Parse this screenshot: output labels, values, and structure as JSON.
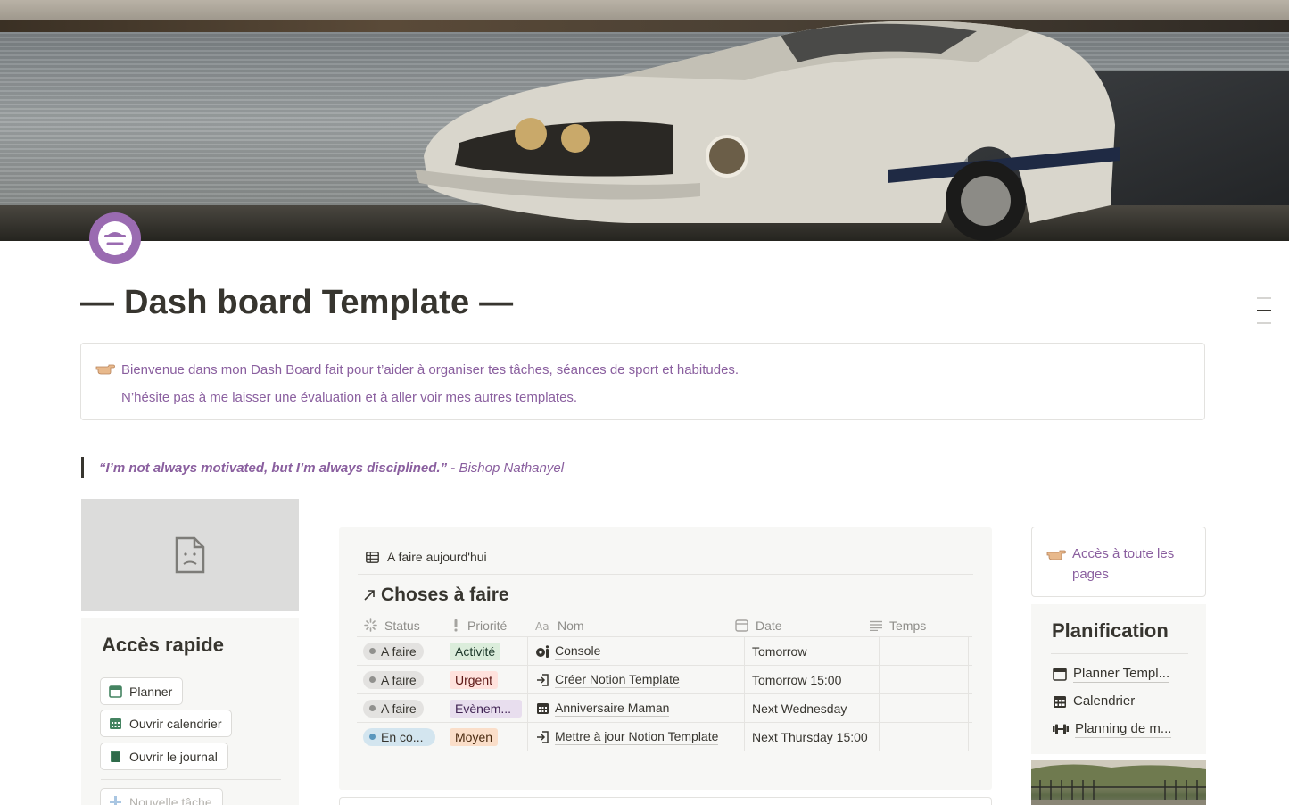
{
  "page": {
    "title": "— Dash board Template —",
    "icon": "purple-face-icon"
  },
  "callout": {
    "icon": "pointing-hand-icon",
    "line1": "Bienvenue dans mon Dash Board fait pour t’aider à organiser tes tâches, séances de sport et habitudes.",
    "line2": "N’hésite pas à me laisser une évaluation et à aller voir mes autres templates."
  },
  "quote": {
    "text": "“I’m not always motivated, but I’m always disciplined.”",
    "separator": " - ",
    "author": "Bishop Nathanyel"
  },
  "quick_access": {
    "heading": "Accès rapide",
    "buttons": [
      {
        "label": "Planner",
        "icon": "calendar-icon"
      },
      {
        "label": "Ouvrir calendrier",
        "icon": "calendar-grid-icon"
      },
      {
        "label": "Ouvrir le journal",
        "icon": "journal-icon"
      },
      {
        "label": "Nouvelle tâche",
        "icon": "plus-icon"
      }
    ]
  },
  "database": {
    "view_name": "A faire aujourd'hui",
    "title": "Choses à faire",
    "columns": {
      "status": "Status",
      "priority": "Priorité",
      "name": "Nom",
      "date": "Date",
      "time": "Temps"
    },
    "rows": [
      {
        "status": "A faire",
        "priority": "Activité",
        "name": "Console",
        "date": "Tomorrow",
        "time": ""
      },
      {
        "status": "A faire",
        "priority": "Urgent",
        "name": "Créer Notion Template",
        "date": "Tomorrow 15:00",
        "time": ""
      },
      {
        "status": "A faire",
        "priority": "Evènem...",
        "name": "Anniversaire Maman",
        "date": "Next Wednesday",
        "time": ""
      },
      {
        "status": "En co...",
        "priority": "Moyen",
        "name": "Mettre à jour Notion Template",
        "date": "Next Thursday 15:00",
        "time": ""
      }
    ],
    "colors": {
      "status_todo_bg": "#e3e2e0",
      "status_todo_dot": "#91918e",
      "status_progress_bg": "#d3e5ef",
      "status_progress_dot": "#5b97bd",
      "tag_activite": "#dbeddb",
      "tag_urgent": "#ffe2dd",
      "tag_evenement": "#e8deee",
      "tag_moyen": "#fadec9"
    }
  },
  "access_all": {
    "icon": "pointing-hand-icon",
    "text": "Accès à toute les pages"
  },
  "planning": {
    "heading": "Planification",
    "links": [
      {
        "label": "Planner Templ...",
        "icon": "calendar-icon"
      },
      {
        "label": "Calendrier",
        "icon": "calendar-grid-icon"
      },
      {
        "label": "Planning de m...",
        "icon": "dumbbell-icon"
      }
    ]
  },
  "theme": {
    "accent_purple": "#8a5f9f",
    "text": "#37352f"
  }
}
